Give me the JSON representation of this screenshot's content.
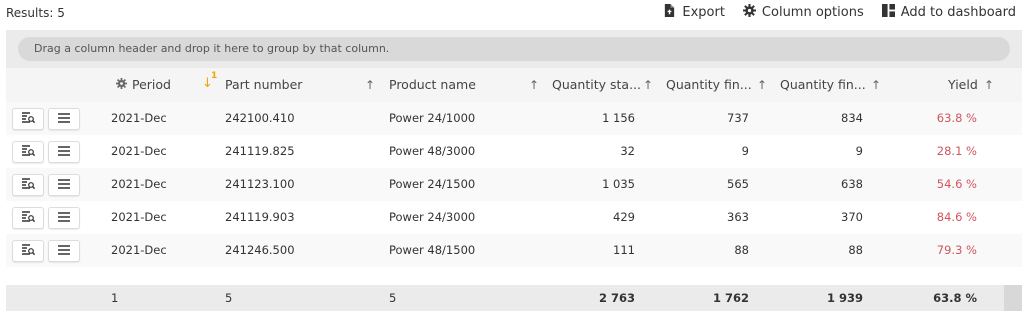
{
  "results_label": "Results: 5",
  "toolbar": {
    "export_label": "Export",
    "column_options_label": "Column options",
    "add_dashboard_label": "Add to dashboard"
  },
  "group_zone_text": "Drag a column header and drop it here to group by that column.",
  "columns": {
    "period": "Period",
    "part_number": "Part number",
    "product_name": "Product name",
    "qty_started": "Quantity sta...",
    "qty_fin1": "Quantity fin...",
    "qty_fin2": "Quantity fin...",
    "yield": "Yield",
    "part_sort_order": "1"
  },
  "rows": [
    {
      "period": "2021-Dec",
      "part": "242100.410",
      "product": "Power 24/1000",
      "started": "1 156",
      "fin1": "737",
      "fin2": "834",
      "yield": "63.8 %"
    },
    {
      "period": "2021-Dec",
      "part": "241119.825",
      "product": "Power 48/3000",
      "started": "32",
      "fin1": "9",
      "fin2": "9",
      "yield": "28.1 %"
    },
    {
      "period": "2021-Dec",
      "part": "241123.100",
      "product": "Power 24/1500",
      "started": "1 035",
      "fin1": "565",
      "fin2": "638",
      "yield": "54.6 %"
    },
    {
      "period": "2021-Dec",
      "part": "241119.903",
      "product": "Power 24/3000",
      "started": "429",
      "fin1": "363",
      "fin2": "370",
      "yield": "84.6 %"
    },
    {
      "period": "2021-Dec",
      "part": "241246.500",
      "product": "Power 48/1500",
      "started": "111",
      "fin1": "88",
      "fin2": "88",
      "yield": "79.3 %"
    }
  ],
  "footer": {
    "period": "1",
    "part": "5",
    "product": "5",
    "started": "2 763",
    "fin1": "1 762",
    "fin2": "1 939",
    "yield": "63.8 %"
  },
  "colors": {
    "yield_text": "#d0555d",
    "sort_icon": "#f0a500"
  },
  "icons": {
    "export": "file-export-icon",
    "column_options": "gear-icon",
    "dashboard": "dashboard-icon",
    "row_details": "details-search-icon",
    "row_menu": "menu-icon",
    "sort_up": "arrow-up-icon",
    "sort_down": "arrow-down-icon"
  }
}
